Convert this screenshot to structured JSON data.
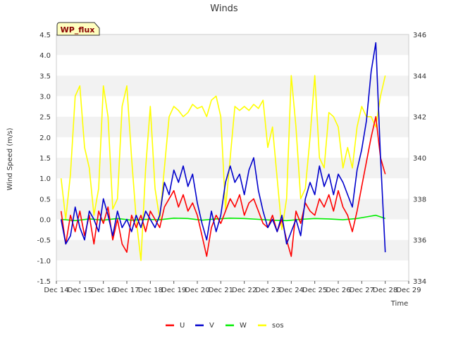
{
  "chart_data": {
    "type": "line",
    "title": "Winds",
    "badge": "WP_flux",
    "xlabel": "Time",
    "ylabel": "Wind Speed (m/s)",
    "y2label": "",
    "ylim": [
      -1.5,
      4.5
    ],
    "y2lim": [
      334,
      346
    ],
    "xlim": [
      14,
      29
    ],
    "yticks": [
      "-1.5",
      "-1.0",
      "-0.5",
      "0.0",
      "0.5",
      "1.0",
      "1.5",
      "2.0",
      "2.5",
      "3.0",
      "3.5",
      "4.0",
      "4.5"
    ],
    "y2ticks": [
      "334",
      "336",
      "338",
      "340",
      "342",
      "344",
      "346"
    ],
    "xticks": [
      "Dec 14",
      "Dec 15",
      "Dec 16",
      "Dec 17",
      "Dec 18",
      "Dec 19",
      "Dec 20",
      "Dec 21",
      "Dec 22",
      "Dec 23",
      "Dec 24",
      "Dec 25",
      "Dec 26",
      "Dec 27",
      "Dec 28",
      "Dec 29"
    ],
    "grid": "horizontal bands",
    "legend_position": "bottom-center",
    "series": [
      {
        "name": "U",
        "axis": "left",
        "color": "#ff0000",
        "x": [
          14.2,
          14.4,
          14.6,
          14.8,
          15.0,
          15.2,
          15.4,
          15.6,
          15.8,
          16.0,
          16.2,
          16.4,
          16.6,
          16.8,
          17.0,
          17.2,
          17.4,
          17.6,
          17.8,
          18.0,
          18.2,
          18.4,
          18.6,
          18.8,
          19.0,
          19.2,
          19.4,
          19.6,
          19.8,
          20.0,
          20.2,
          20.4,
          20.6,
          20.8,
          21.0,
          21.2,
          21.4,
          21.6,
          21.8,
          22.0,
          22.2,
          22.4,
          22.6,
          22.8,
          23.0,
          23.2,
          23.4,
          23.6,
          23.8,
          24.0,
          24.2,
          24.4,
          24.6,
          24.8,
          25.0,
          25.2,
          25.4,
          25.6,
          25.8,
          26.0,
          26.2,
          26.4,
          26.6,
          26.8,
          27.0,
          27.2,
          27.4,
          27.6,
          27.8,
          28.0
        ],
        "y": [
          0.2,
          -0.6,
          0.1,
          -0.3,
          0.2,
          -0.4,
          0.1,
          -0.6,
          0.2,
          -0.1,
          0.3,
          -0.5,
          0.0,
          -0.6,
          -0.8,
          0.1,
          -0.2,
          0.1,
          -0.3,
          0.2,
          0.0,
          -0.2,
          0.3,
          0.5,
          0.7,
          0.3,
          0.6,
          0.2,
          0.4,
          0.1,
          -0.4,
          -0.9,
          -0.2,
          0.1,
          -0.1,
          0.2,
          0.5,
          0.3,
          0.6,
          0.1,
          0.4,
          0.5,
          0.2,
          -0.1,
          -0.2,
          0.1,
          -0.3,
          0.0,
          -0.5,
          -0.9,
          0.2,
          -0.1,
          0.4,
          0.2,
          0.1,
          0.5,
          0.3,
          0.6,
          0.2,
          0.7,
          0.3,
          0.1,
          -0.3,
          0.2,
          0.8,
          1.4,
          2.0,
          2.5,
          1.5,
          1.1
        ]
      },
      {
        "name": "V",
        "axis": "left",
        "color": "#0000cc",
        "x": [
          14.2,
          14.4,
          14.6,
          14.8,
          15.0,
          15.2,
          15.4,
          15.6,
          15.8,
          16.0,
          16.2,
          16.4,
          16.6,
          16.8,
          17.0,
          17.2,
          17.4,
          17.6,
          17.8,
          18.0,
          18.2,
          18.4,
          18.6,
          18.8,
          19.0,
          19.2,
          19.4,
          19.6,
          19.8,
          20.0,
          20.2,
          20.4,
          20.6,
          20.8,
          21.0,
          21.2,
          21.4,
          21.6,
          21.8,
          22.0,
          22.2,
          22.4,
          22.6,
          22.8,
          23.0,
          23.2,
          23.4,
          23.6,
          23.8,
          24.0,
          24.2,
          24.4,
          24.6,
          24.8,
          25.0,
          25.2,
          25.4,
          25.6,
          25.8,
          26.0,
          26.2,
          26.4,
          26.6,
          26.8,
          27.0,
          27.2,
          27.4,
          27.6,
          27.8,
          28.0
        ],
        "y": [
          0.0,
          -0.6,
          -0.4,
          0.3,
          -0.2,
          -0.5,
          0.2,
          0.0,
          -0.3,
          0.5,
          0.1,
          -0.4,
          0.2,
          -0.2,
          0.0,
          -0.3,
          0.1,
          -0.2,
          0.2,
          0.0,
          -0.2,
          0.1,
          0.9,
          0.6,
          1.2,
          0.9,
          1.3,
          0.8,
          1.1,
          0.4,
          -0.1,
          -0.5,
          0.2,
          -0.3,
          0.1,
          0.9,
          1.3,
          0.9,
          1.1,
          0.6,
          1.2,
          1.5,
          0.7,
          0.2,
          -0.2,
          0.0,
          -0.3,
          0.1,
          -0.6,
          -0.3,
          0.0,
          -0.4,
          0.5,
          0.9,
          0.6,
          1.3,
          0.8,
          1.1,
          0.6,
          1.1,
          0.9,
          0.6,
          0.3,
          1.2,
          1.7,
          2.4,
          3.6,
          4.3,
          1.5,
          -0.8
        ]
      },
      {
        "name": "W",
        "axis": "left",
        "color": "#00ee00",
        "x": [
          14.2,
          14.8,
          15.4,
          16.0,
          16.6,
          17.2,
          17.8,
          18.4,
          19.0,
          19.6,
          20.2,
          20.8,
          21.4,
          22.0,
          22.6,
          23.2,
          23.8,
          24.4,
          25.0,
          25.6,
          26.2,
          26.8,
          27.2,
          27.6,
          28.0
        ],
        "y": [
          0.0,
          -0.03,
          0.01,
          -0.02,
          0.02,
          -0.02,
          0.0,
          -0.01,
          0.03,
          0.02,
          -0.02,
          0.01,
          0.03,
          0.02,
          0.0,
          -0.02,
          -0.03,
          0.0,
          0.02,
          0.01,
          -0.01,
          0.02,
          0.06,
          0.1,
          0.02
        ]
      },
      {
        "name": "sos",
        "axis": "right",
        "color": "#ffff00",
        "x": [
          14.2,
          14.4,
          14.6,
          14.8,
          15.0,
          15.2,
          15.4,
          15.6,
          15.8,
          16.0,
          16.2,
          16.4,
          16.6,
          16.8,
          17.0,
          17.2,
          17.4,
          17.6,
          17.8,
          18.0,
          18.2,
          18.4,
          18.6,
          18.8,
          19.0,
          19.2,
          19.4,
          19.6,
          19.8,
          20.0,
          20.2,
          20.4,
          20.6,
          20.8,
          21.0,
          21.2,
          21.4,
          21.6,
          21.8,
          22.0,
          22.2,
          22.4,
          22.6,
          22.8,
          23.0,
          23.2,
          23.4,
          23.6,
          23.8,
          24.0,
          24.2,
          24.4,
          24.6,
          24.8,
          25.0,
          25.2,
          25.4,
          25.6,
          25.8,
          26.0,
          26.2,
          26.4,
          26.6,
          26.8,
          27.0,
          27.2,
          27.4,
          27.6,
          27.8,
          28.0
        ],
        "y": [
          339.0,
          337.0,
          339.2,
          343.0,
          343.5,
          340.5,
          339.5,
          337.2,
          338.5,
          343.5,
          342.0,
          337.5,
          338.0,
          342.5,
          343.5,
          340.0,
          337.0,
          335.0,
          339.5,
          342.5,
          338.5,
          337.0,
          339.5,
          342.0,
          342.5,
          342.3,
          342.0,
          342.2,
          342.6,
          342.4,
          342.5,
          342.0,
          342.8,
          343.0,
          342.0,
          337.5,
          340.0,
          342.5,
          342.3,
          342.5,
          342.3,
          342.6,
          342.4,
          342.8,
          340.5,
          341.5,
          339.0,
          336.5,
          338.0,
          344.0,
          341.5,
          338.0,
          338.5,
          341.0,
          344.0,
          340.0,
          339.5,
          342.2,
          342.0,
          341.5,
          339.5,
          340.5,
          339.5,
          341.5,
          342.5,
          342.0,
          342.0,
          341.5,
          343.0,
          344.0
        ]
      }
    ]
  }
}
